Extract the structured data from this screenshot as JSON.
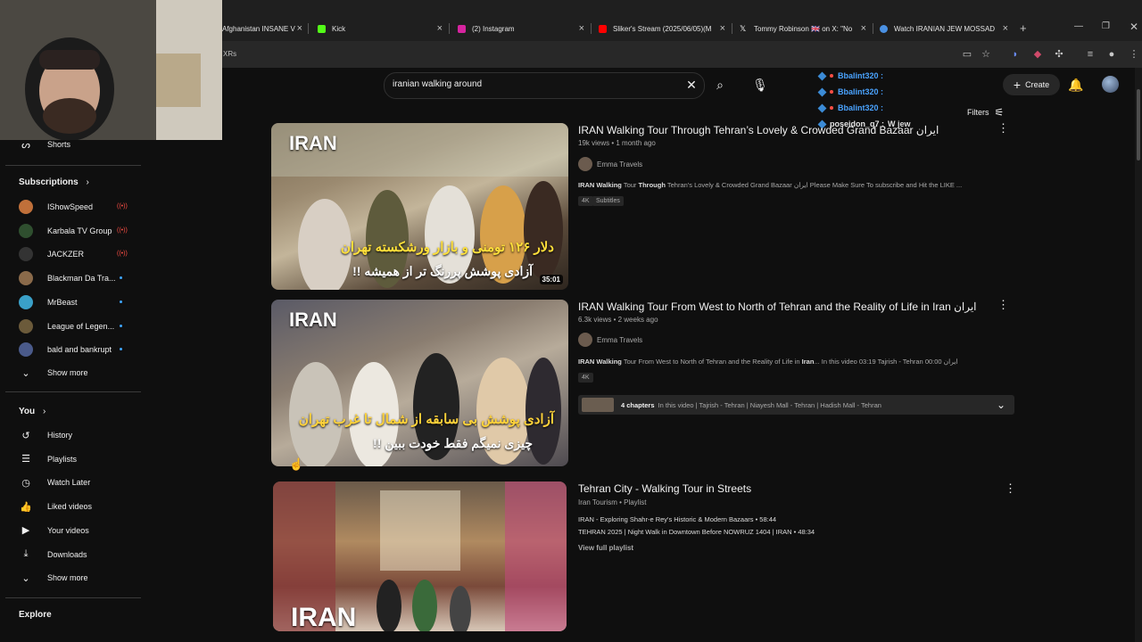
{
  "browser": {
    "tabs": [
      {
        "label": "Afghanistan INSANE V",
        "color": "#c0392b"
      },
      {
        "label": "Kick",
        "color": "#53fc18"
      },
      {
        "label": "(2) Instagram",
        "color": "#d6249f"
      },
      {
        "label": "Sliker's Stream (2025/06/05)(M",
        "color": "#ff0000"
      },
      {
        "label": "Tommy Robinson 🇬🇧 on X: \"No",
        "color": "#ffffff"
      },
      {
        "label": "Watch IRANIAN JEW MOSSAD",
        "color": "#4a90e2"
      }
    ],
    "url_fragment": "XRs"
  },
  "search": {
    "value": "iranian walking around"
  },
  "header": {
    "create_label": "Create",
    "filters_label": "Filters"
  },
  "chat": [
    {
      "user": "Bbalint320 :",
      "msg": ""
    },
    {
      "user": "Bbalint320 :",
      "msg": ""
    },
    {
      "user": "Bbalint320 :",
      "msg": ""
    },
    {
      "user": "poseidon_q7 :",
      "msg": "W jew"
    }
  ],
  "sidebar": {
    "shorts_label": "Shorts",
    "subscriptions_heading": "Subscriptions",
    "subscriptions": [
      {
        "name": "IShowSpeed",
        "color": "#c0703a",
        "status": "live"
      },
      {
        "name": "Karbala TV Group",
        "color": "#2f4f2f",
        "status": "live"
      },
      {
        "name": "JACKZER",
        "color": "#333333",
        "status": "live"
      },
      {
        "name": "Blackman Da Tra...",
        "color": "#8a6a4a",
        "status": "new"
      },
      {
        "name": "MrBeast",
        "color": "#3aa0c8",
        "status": "new"
      },
      {
        "name": "League of Legen...",
        "color": "#6b5a3a",
        "status": "new"
      },
      {
        "name": "bald and bankrupt",
        "color": "#4a5a8a",
        "status": "new"
      }
    ],
    "show_more_1": "Show more",
    "you_heading": "You",
    "you_items": [
      {
        "label": "History",
        "icon": "history-icon",
        "glyph": "↺"
      },
      {
        "label": "Playlists",
        "icon": "playlists-icon",
        "glyph": "☰"
      },
      {
        "label": "Watch Later",
        "icon": "clock-icon",
        "glyph": "◷"
      },
      {
        "label": "Liked videos",
        "icon": "thumbs-up-icon",
        "glyph": "👍"
      },
      {
        "label": "Your videos",
        "icon": "video-icon",
        "glyph": "▶"
      },
      {
        "label": "Downloads",
        "icon": "download-icon",
        "glyph": "⤓"
      }
    ],
    "show_more_2": "Show more",
    "explore_heading": "Explore"
  },
  "results": [
    {
      "title": "IRAN Walking Tour Through Tehran’s Lovely & Crowded Grand Bazaar ایران",
      "meta": "19k views • 1 month ago",
      "channel": "Emma Travels",
      "desc_bold": "IRAN Walking",
      "desc_mid": " Tour ",
      "desc_bold2": "Through",
      "desc_rest": " Tehran's Lovely & Crowded Grand Bazaar ایران Please Make Sure To subscribe and Hit the LIKE ...",
      "badges": [
        "4K",
        "Subtitles"
      ],
      "thumb_label": "IRAN",
      "thumb_fa1": "دلار ۱۲۶ تومنی و بازار ورشکسته تهران",
      "thumb_fa2": "آزادی پوشش پررنگ تر از همیشه !!",
      "duration": "35:01"
    },
    {
      "title": "IRAN Walking Tour From West to North of Tehran and the Reality of Life in Iran ایران",
      "meta": "6.3k views • 2 weeks ago",
      "channel": "Emma Travels",
      "desc_bold": "IRAN Walking",
      "desc_rest": " Tour From West to North of Tehran and the Reality of Life in ",
      "desc_bold2": "Iran",
      "desc_rest2": "... In this video 03:19 Tajrish - Tehran 00:00 ایران",
      "badges": [
        "4K"
      ],
      "chapters_label": "4 chapters",
      "chapters_text": "In this video | Tajrish - Tehran | Niayesh Mall - Tehran | Hadish Mall - Tehran",
      "thumb_label": "IRAN",
      "thumb_fa1": "آزادی پوشش بی سابقه از شمال تا غرب تهران",
      "thumb_fa2": "چیزی نمیگم فقط خودت ببین !!",
      "duration": ""
    },
    {
      "title": "Tehran City - Walking Tour in Streets",
      "meta": "Iran Tourism • Playlist",
      "items": [
        "IRAN - Exploring Shahr-e Rey's Historic & Modern Bazaars • 58:44",
        "TEHRAN 2025 | Night Walk in Downtown Before NOWRUZ 1404 | IRAN • 48:34"
      ],
      "view_full": "View full playlist",
      "thumb_label": "IRAN"
    }
  ]
}
